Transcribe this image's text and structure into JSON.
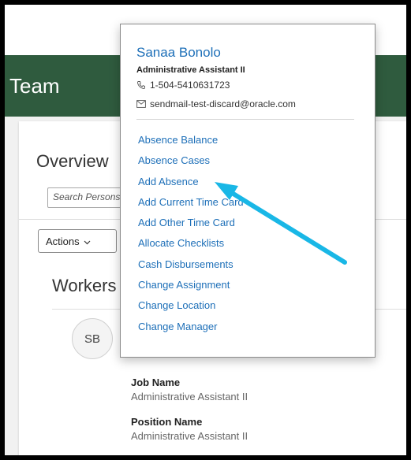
{
  "page": {
    "title": "Team"
  },
  "overview": {
    "title": "Overview",
    "search_placeholder": "Search Persons",
    "actions_label": "Actions"
  },
  "workers": {
    "title": "Workers",
    "avatar_initials": "SB",
    "fields": [
      {
        "label": "Job Name",
        "value": "Administrative Assistant II"
      },
      {
        "label": "Position Name",
        "value": "Administrative Assistant II"
      }
    ]
  },
  "popup": {
    "name": "Sanaa Bonolo",
    "job_title": "Administrative Assistant II",
    "phone": "1-504-5410631723",
    "email": "sendmail-test-discard@oracle.com",
    "menu_items": [
      "Absence Balance",
      "Absence Cases",
      "Add Absence",
      "Add Current Time Card",
      "Add Other Time Card",
      "Allocate Checklists",
      "Cash Disbursements",
      "Change Assignment",
      "Change Location",
      "Change Manager"
    ]
  },
  "colors": {
    "header_green": "#2f5b3e",
    "link_blue": "#1d6fb8",
    "annotation_arrow": "#19b7e6"
  }
}
